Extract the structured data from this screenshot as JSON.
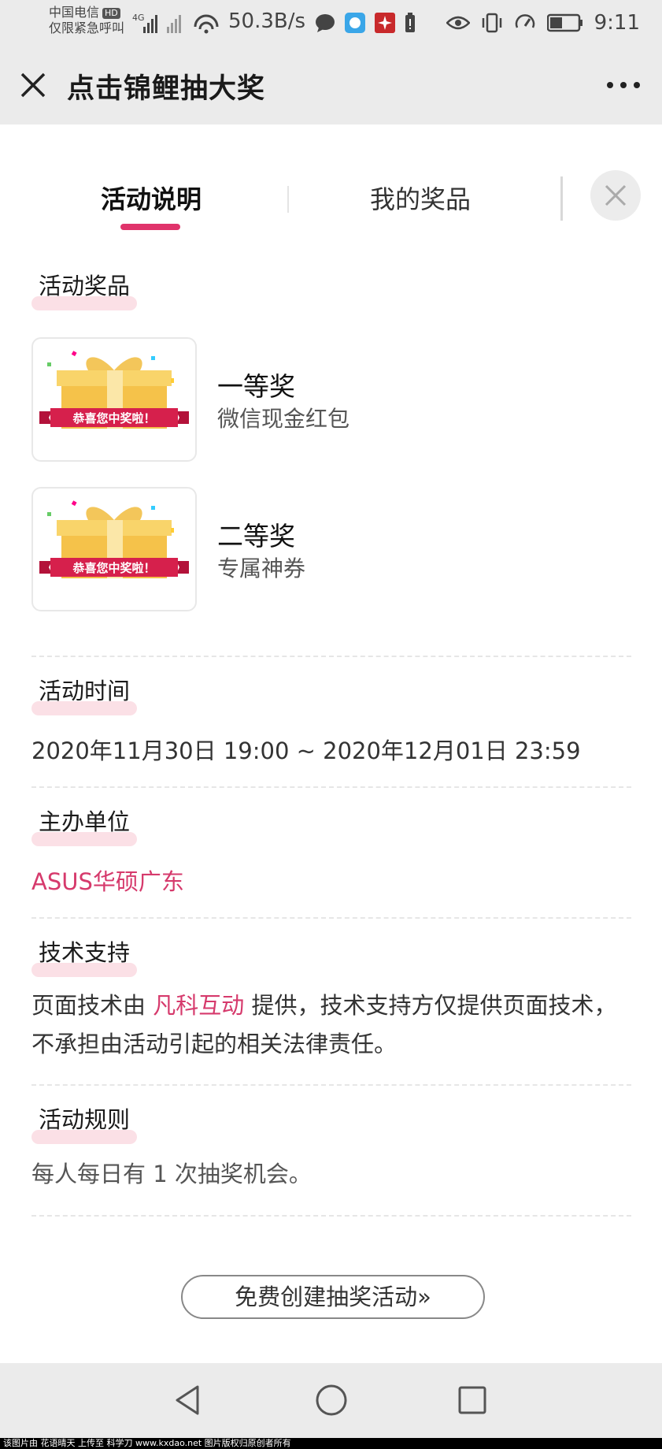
{
  "status_bar": {
    "carrier_line1": "中国电信",
    "hd_badge": "HD",
    "carrier_line2": "仅限紧急呼叫",
    "network_type": "4G",
    "net_speed": "50.3B/s",
    "time": "9:11"
  },
  "title_bar": {
    "title": "点击锦鲤抽大奖"
  },
  "tabs": [
    {
      "label": "活动说明",
      "active": true
    },
    {
      "label": "我的奖品",
      "active": false
    }
  ],
  "prizes_section": {
    "title": "活动奖品",
    "ribbon_text": "恭喜您中奖啦！",
    "items": [
      {
        "name": "一等奖",
        "desc": "微信现金红包"
      },
      {
        "name": "二等奖",
        "desc": "专属神券"
      }
    ]
  },
  "time_section": {
    "title": "活动时间",
    "value": "2020年11月30日 19:00 ~ 2020年12月01日 23:59"
  },
  "organizer_section": {
    "title": "主办单位",
    "value": "ASUS华硕广东"
  },
  "tech_section": {
    "title": "技术支持",
    "text_before": "页面技术由 ",
    "link_text": "凡科互动",
    "text_after": " 提供，技术支持方仅提供页面技术，不承担由活动引起的相关法律责任。"
  },
  "rules_section": {
    "title": "活动规则",
    "value": "每人每日有 1 次抽奖机会。"
  },
  "cta": {
    "label": "免费创建抽奖活动»"
  },
  "footer": {
    "watermark": "该图片由 花语晴天 上传至 科学刀 www.kxdao.net 图片版权归原创者所有"
  },
  "colors": {
    "accent": "#e0336b",
    "link": "#d63a6c",
    "highlight": "#fbe0e6",
    "bar_bg": "#ebebeb"
  }
}
